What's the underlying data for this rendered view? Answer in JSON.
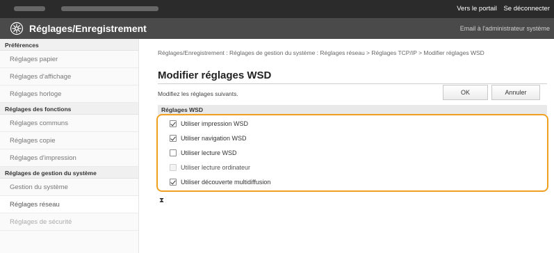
{
  "topbar": {
    "links": [
      "Vers le portail",
      "Se déconnecter"
    ]
  },
  "header": {
    "title": "Réglages/Enregistrement",
    "admin_email": "Email à l'administrateur système",
    "icon": "gear-icon"
  },
  "sidebar": {
    "sections": [
      {
        "title": "Préférences",
        "items": [
          {
            "label": "Réglages papier"
          },
          {
            "label": "Réglages d'affichage"
          },
          {
            "label": "Réglages horloge"
          }
        ]
      },
      {
        "title": "Réglages des fonctions",
        "items": [
          {
            "label": "Réglages communs"
          },
          {
            "label": "Réglages copie"
          },
          {
            "label": "Réglages d'impression"
          }
        ]
      },
      {
        "title": "Réglages de gestion du système",
        "items": [
          {
            "label": "Gestion du système"
          },
          {
            "label": "Réglages réseau"
          },
          {
            "label": "Réglages de sécurité"
          }
        ]
      }
    ]
  },
  "main": {
    "breadcrumb": "Réglages/Enregistrement : Réglages de gestion du système : Réglages réseau > Réglages TCP/IP > Modifier réglages WSD",
    "title": "Modifier réglages WSD",
    "instructions": "Modifiez les réglages suivants.",
    "ok_label": "OK",
    "cancel_label": "Annuler",
    "section_title": "Réglages WSD",
    "options": [
      {
        "label": "Utiliser impression WSD",
        "checked": true
      },
      {
        "label": "Utiliser navigation WSD",
        "checked": true
      },
      {
        "label": "Utiliser lecture WSD",
        "checked": false
      },
      {
        "label": "Utiliser lecture ordinateur",
        "checked": false,
        "disabled": true
      },
      {
        "label": "Utiliser découverte multidiffusion",
        "checked": true
      }
    ],
    "highlight_color": "#f0a020"
  }
}
